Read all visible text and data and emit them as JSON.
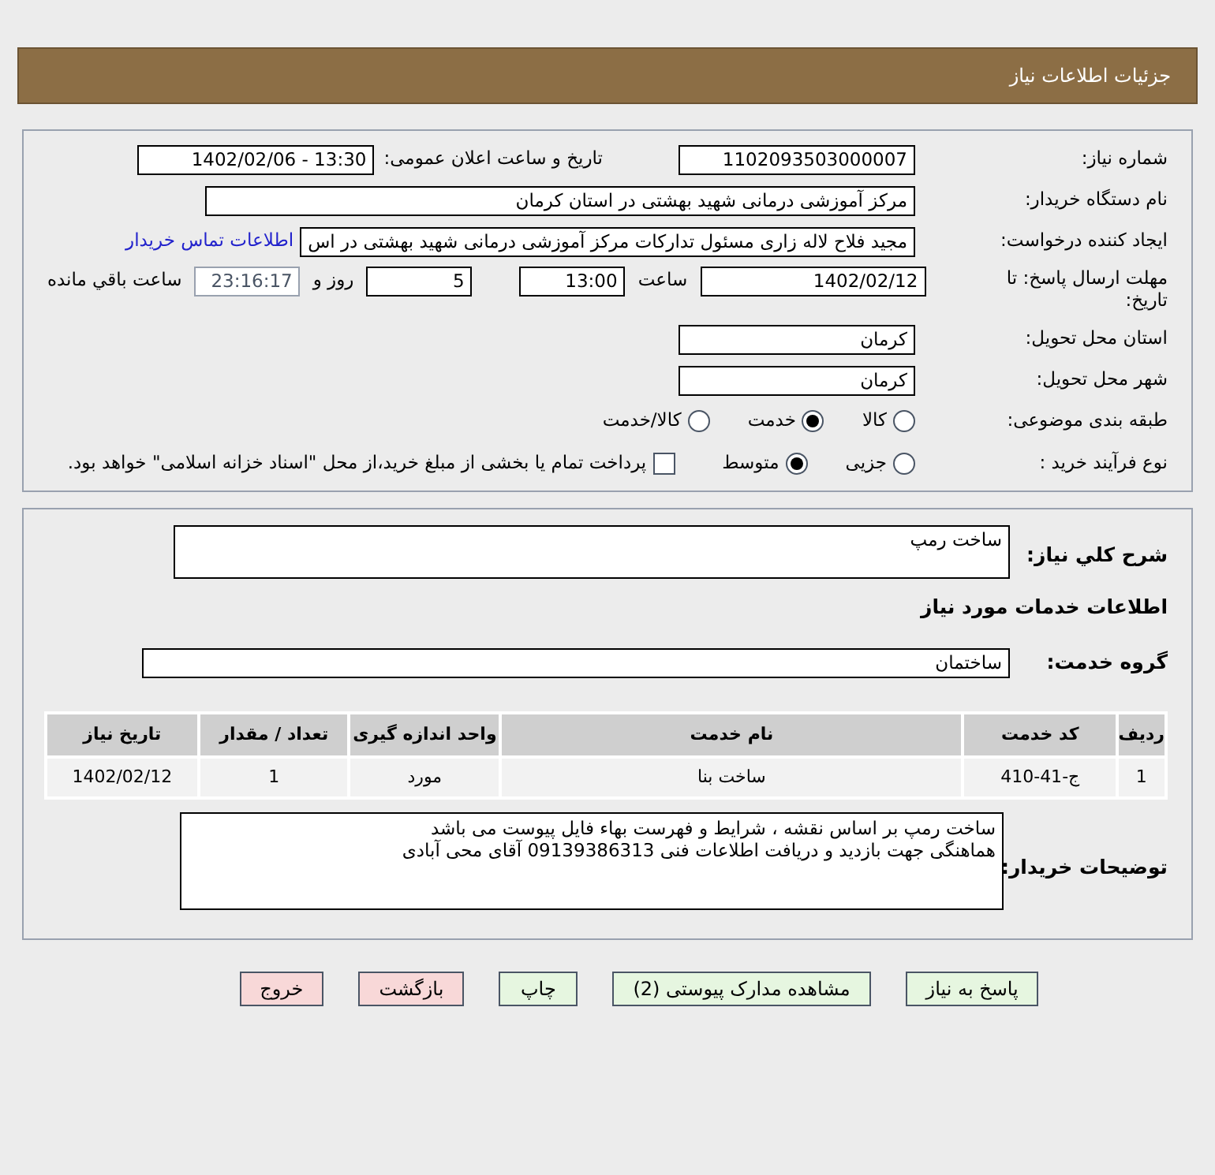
{
  "header": {
    "title": "جزئیات اطلاعات نیاز"
  },
  "need_number": {
    "label": "شماره نیاز:",
    "value": "1102093503000007"
  },
  "announce": {
    "label": "تاریخ و ساعت اعلان عمومی:",
    "value": "1402/02/06 - 13:30"
  },
  "buyer_org": {
    "label": "نام دستگاه خریدار:",
    "value": "مرکز آموزشی درمانی شهید بهشتی در استان کرمان"
  },
  "requester": {
    "label": "ایجاد کننده درخواست:",
    "value": "مجید فلاح لاله زاری مسئول تدارکات مرکز آموزشی درمانی شهید بهشتی در اس",
    "link": "اطلاعات تماس خریدار"
  },
  "deadline": {
    "label": "مهلت ارسال پاسخ: تا تاریخ:",
    "date": "1402/02/12",
    "time_label": "ساعت",
    "time": "13:00",
    "days": "5",
    "days_label": "روز و",
    "remaining": "23:16:17",
    "remaining_label": "ساعت باقي مانده"
  },
  "province": {
    "label": "استان محل تحویل:",
    "value": "کرمان"
  },
  "city": {
    "label": "شهر محل تحویل:",
    "value": "کرمان"
  },
  "category": {
    "label": "طبقه بندی موضوعی:",
    "options": [
      {
        "label": "کالا",
        "selected": false
      },
      {
        "label": "خدمت",
        "selected": true
      },
      {
        "label": "کالا/خدمت",
        "selected": false
      }
    ]
  },
  "process": {
    "label": "نوع فرآیند خرید :",
    "options": [
      {
        "label": "جزیی",
        "selected": false
      },
      {
        "label": "متوسط",
        "selected": true
      }
    ],
    "checkbox": {
      "checked": false,
      "text": "پرداخت تمام یا بخشی از مبلغ خرید،از محل \"اسناد خزانه اسلامی\" خواهد بود."
    }
  },
  "summary": {
    "label": "شرح کلي نياز:",
    "value": "ساخت رمپ"
  },
  "services_heading": "اطلاعات خدمات مورد نیاز",
  "service_group": {
    "label": "گروه خدمت:",
    "value": "ساختمان"
  },
  "table": {
    "columns": [
      "ردیف",
      "کد خدمت",
      "نام خدمت",
      "واحد اندازه گیری",
      "تعداد / مقدار",
      "تاریخ نیاز"
    ],
    "rows": [
      [
        "1",
        "ج-41-410",
        "ساخت بنا",
        "مورد",
        "1",
        "1402/02/12"
      ]
    ]
  },
  "buyer_notes": {
    "label": "توضیحات خریدار:",
    "lines": [
      "ساخت رمپ بر اساس نقشه ، شرایط و فهرست بهاء فایل پیوست می باشد",
      "هماهنگی جهت بازدید و دریافت اطلاعات فنی 09139386313 آقای محی آبادی"
    ]
  },
  "buttons": [
    {
      "label": "پاسخ به نیاز",
      "kind": "green"
    },
    {
      "label": "مشاهده مدارک پیوستی (2)",
      "kind": "green"
    },
    {
      "label": "چاپ",
      "kind": "green"
    },
    {
      "label": "بازگشت",
      "kind": "red"
    },
    {
      "label": "خروج",
      "kind": "red"
    }
  ]
}
